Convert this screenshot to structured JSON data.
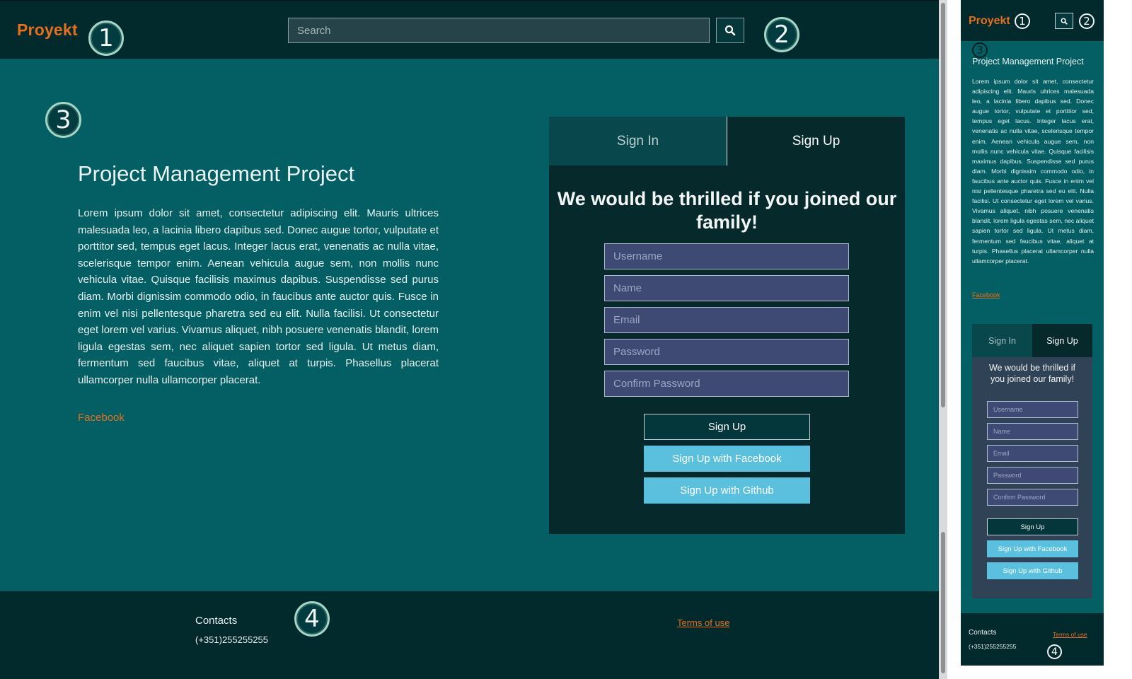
{
  "desktop": {
    "header": {
      "logo": "Proyekt",
      "search_placeholder": "Search",
      "search_icon": "search-icon",
      "marker_1": "1",
      "marker_2": "2"
    },
    "main": {
      "marker_3": "3",
      "title": "Project Management Project",
      "body": "Lorem ipsum dolor sit amet, consectetur adipiscing elit. Mauris ultrices malesuada leo, a lacinia libero dapibus sed. Donec augue tortor, vulputate et porttitor sed, tempus eget lacus. Integer lacus erat, venenatis ac nulla vitae, scelerisque tempor enim. Aenean vehicula augue sem, non mollis nunc vehicula vitae. Quisque facilisis maximus dapibus. Suspendisse sed purus diam. Morbi dignissim commodo odio, in faucibus ante auctor quis. Fusce in enim vel nisi pellentesque pharetra sed eu elit. Nulla facilisi. Ut consectetur eget lorem vel varius. Vivamus aliquet, nibh posuere venenatis blandit, lorem ligula egestas sem, nec aliquet sapien tortor sed ligula. Ut metus diam, fermentum sed faucibus vitae, aliquet at turpis. Phasellus placerat ullamcorper nulla ullamcorper placerat.",
      "facebook_link": "Facebook"
    },
    "card": {
      "tabs": [
        "Sign In",
        "Sign Up"
      ],
      "active_tab": "Sign Up",
      "heading": "We would be thrilled if you joined our family!",
      "fields": [
        "Username",
        "Name",
        "Email",
        "Password",
        "Confirm Password"
      ],
      "buttons": {
        "signup": "Sign Up",
        "facebook": "Sign Up with Facebook",
        "github": "Sign Up with Github"
      }
    },
    "footer": {
      "contacts_label": "Contacts",
      "phone": "(+351)255255255",
      "terms": "Terms of use",
      "marker_4": "4"
    }
  },
  "mobile": {
    "header": {
      "logo": "Proyekt",
      "marker_1": "1",
      "marker_2": "2"
    },
    "main": {
      "marker_3": "3",
      "title": "Project Management Project",
      "body": "Lorem ipsum dolor sit amet, consectetur adipiscing elit. Mauris ultrices malesuada leo, a lacinia libero dapibus sed. Donec augue tortor, vulputate et porttitor sed, tempus eget lacus. Integer lacus erat, venenatis ac nulla vitae, scelerisque tempor enim. Aenean vehicula augue sem, non mollis nunc vehicula vitae. Quisque facilisis maximus dapibus. Suspendisse sed purus diam. Morbi dignissim commodo odio, in faucibus ante auctor quis. Fusce in enim vel nisi pellentesque pharetra sed eu elit. Nulla facilisi. Ut consectetur eget lorem vel varius. Vivamus aliquet, nibh posuere venenatis blandit, lorem ligula egestas sem, nec aliquet sapien tortor sed ligula. Ut metus diam, fermentum sed faucibus vitae, aliquet at turpis. Phasellus placerat ullamcorper nulla ullamcorper placerat.",
      "facebook_link": "Facebook"
    },
    "card": {
      "tabs": [
        "Sign In",
        "Sign Up"
      ],
      "heading": "We would be thrilled if you joined our family!",
      "fields": [
        "Username",
        "Name",
        "Email",
        "Password",
        "Confirm Password"
      ],
      "buttons": {
        "signup": "Sign Up",
        "facebook": "Sign Up with Facebook",
        "github": "Sign Up with Github"
      }
    },
    "footer": {
      "contacts_label": "Contacts",
      "phone": "(+351)255255255",
      "terms": "Terms of use",
      "marker_4": "4"
    }
  },
  "colors": {
    "accent": "#e56f1e",
    "header_bg": "#022a2d",
    "page_bg": "#035f63",
    "input_bg": "#3e4a73",
    "social_button": "#5bc0de"
  }
}
